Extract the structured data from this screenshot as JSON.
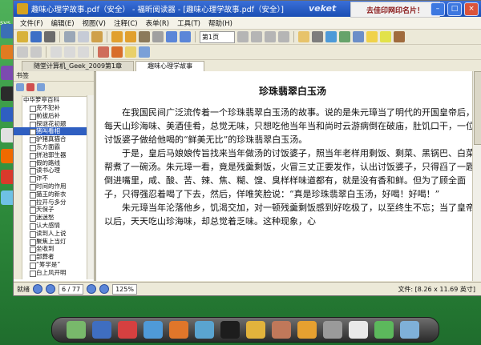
{
  "window": {
    "title": "趣味心理学故事.pdf（安全） - 福昕阅读器 - [趣味心理学故事.pdf（安全）]",
    "brand": "veket",
    "ad_text": "去佳印网印名片！",
    "min_label": "–",
    "max_label": "□",
    "close_label": "×"
  },
  "menu": [
    "文件(F)",
    "编辑(E)",
    "视图(V)",
    "注释(C)",
    "表单(R)",
    "工具(T)",
    "帮助(H)"
  ],
  "toolbar": {
    "zoom_value": "第1页"
  },
  "tabs": [
    {
      "label": "随堂计算机_Geek_2009第1章"
    },
    {
      "label": "趣味心理学故事"
    }
  ],
  "sidebar": {
    "title": "书签",
    "root": "中华箩亭百科",
    "items": [
      "克不犯补",
      "前拔后补",
      "探谜花初题",
      "猪叫看相",
      "驴猪真猫合",
      "东方面霸",
      "拼池郭生器",
      "假的路线",
      "读书心理",
      "诈不",
      "时间的作用",
      "猫王的新衣",
      "拉开与多分",
      "天保子",
      "迷迷愁",
      "认大感情",
      "读到人上说",
      "聚焦上当灯",
      "坐收到",
      "部葬者",
      "“筹学是”",
      "白上风开明"
    ]
  },
  "document": {
    "heading": "珍珠翡翠白玉汤",
    "paragraphs": [
      "在我国民间广泛流传着一个珍珠翡翠白玉汤的故事。说的是朱元璋当了明代的开国皇帝后，每天山珍海味、美酒佳肴，总觉无味，只想吃他当年当和尚时云游病倒在破庙，肚饥口干，一位讨饭婆子做给他喝的“鲜美无比”的珍珠翡翠白玉汤。",
      "于是，皇后马娘娘传旨找来当年做汤的讨饭婆子，照当年老样用剩饭、剩菜、黑锅巴、白菜帮煮了一碗汤。朱元璋一看，竟是残羹剩饭，火冒三丈正要发作，认出讨饭婆子，只得舀了一匙倒进嘴里，咸、酸、苦、辣、焦、糊、馊、臭样样味道都有，就是没有香和鲜。但为了顾全面子，只得强忍着喝了下去，然后，佯唯笑脸说：“真是珍珠翡翠白玉汤，好喝！好喝！”",
      "朱元璋当年沦落他乡，饥渴交加，对一顿残羹剩饭感到好吃极了，以至终生不忘；当了皇帝以后，天天吃山珍海味，却总觉着乏味。这种现象，心"
    ]
  },
  "status": {
    "left_label": "就绪",
    "page_value": "6 / 77",
    "zoom_value": "125%",
    "file_info": "文件: [8.26 x 11.69 英寸]"
  },
  "colors": {
    "titlebar": "#1b4fb3",
    "selection": "#2f5fc1",
    "desktop": "#2f8e3d"
  }
}
